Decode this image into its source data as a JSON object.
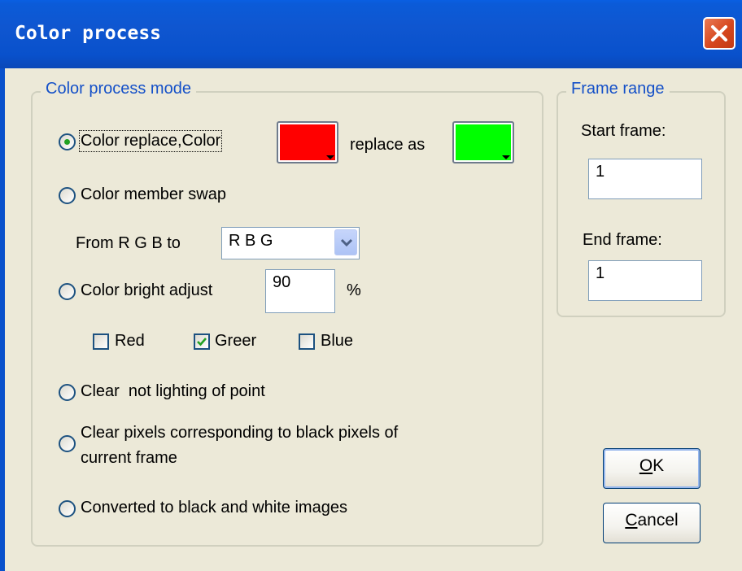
{
  "dialog": {
    "title": "Color process",
    "close_label": "✕"
  },
  "mode_group": {
    "legend": "Color process mode",
    "color_replace": {
      "label": "Color replace,Color",
      "selected": true,
      "from_color": "#ff0000",
      "replace_as_label": "replace as",
      "to_color": "#00ff00"
    },
    "member_swap": {
      "label": "Color member swap",
      "from_label": "From R G B to",
      "selected_option": "R B G"
    },
    "bright_adjust": {
      "label": "Color bright adjust",
      "value": "90",
      "unit": "%",
      "channels": [
        {
          "label": "Red",
          "checked": false
        },
        {
          "label": "Greer",
          "checked": true
        },
        {
          "label": "Blue",
          "checked": false
        }
      ]
    },
    "clear_not_lighting": {
      "label": "Clear  not lighting of point"
    },
    "clear_black_pixels": {
      "label_line1": "Clear pixels corresponding to black pixels of",
      "label_line2": "current frame"
    },
    "convert_bw": {
      "label": "Converted to black and white images"
    }
  },
  "frame_group": {
    "legend": "Frame range",
    "start_label": "Start frame:",
    "start_value": "1",
    "end_label": "End frame:",
    "end_value": "1"
  },
  "buttons": {
    "ok_mnemonic": "O",
    "ok_rest": "K",
    "cancel_mnemonic": "C",
    "cancel_rest": "ancel"
  },
  "colors": {
    "titlebar": "#0951cc",
    "dialog_bg": "#ece9d8",
    "group_legend": "#1450c8"
  }
}
